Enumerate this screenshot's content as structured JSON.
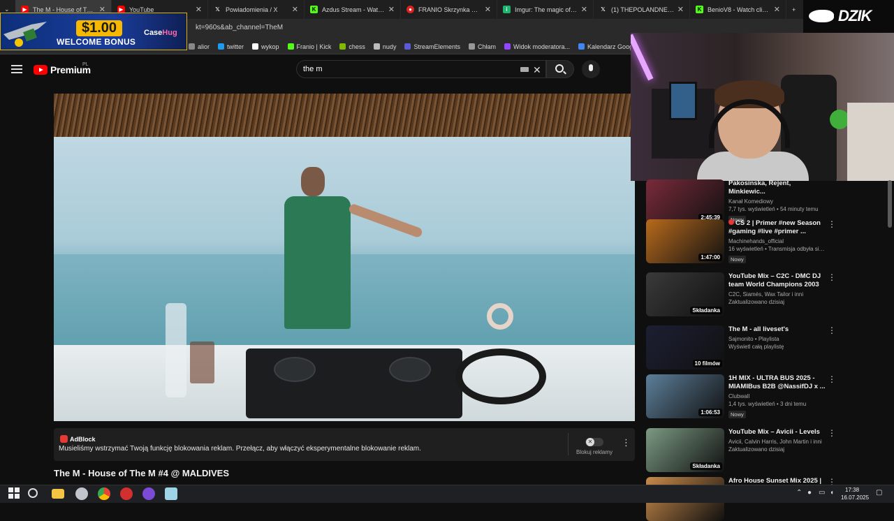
{
  "browser": {
    "tabs": [
      {
        "title": "The M - House of The M",
        "favicon": "youtube",
        "active": true
      },
      {
        "title": "YouTube",
        "favicon": "youtube",
        "active": false
      },
      {
        "title": "Powiadomienia / X",
        "favicon": "x",
        "active": false
      },
      {
        "title": "Azdus Stream - Watch Live",
        "favicon": "kick",
        "active": false
      },
      {
        "title": "FRANIO Skrzynka CS2 (CS)",
        "favicon": "csgo",
        "active": false
      },
      {
        "title": "Imgur: The magic of the",
        "favicon": "imgur",
        "active": false
      },
      {
        "title": "(1) THEPOLANDNEWS",
        "favicon": "x",
        "active": false
      },
      {
        "title": "BenioV8 - Watch clips on",
        "favicon": "kick",
        "active": false
      }
    ],
    "new_tab_label": "+",
    "url": "kt=960s&ab_channel=TheM",
    "bookmarks": [
      {
        "label": "alior"
      },
      {
        "label": "twitter"
      },
      {
        "label": "wykop"
      },
      {
        "label": "Franio | Kick"
      },
      {
        "label": "chess"
      },
      {
        "label": "nudy"
      },
      {
        "label": "StreamElements"
      },
      {
        "label": "Chłam"
      },
      {
        "label": "Widok moderatora..."
      },
      {
        "label": "Kalendarz Google -..."
      }
    ]
  },
  "overlay_ad": {
    "amount": "$1.00",
    "text": "WELCOME BONUS",
    "brand_a": "Case",
    "brand_b": "Hug"
  },
  "streamer_brand": "DZIK",
  "youtube": {
    "logo_text": "Premium",
    "region": "PL",
    "search_value": "the m",
    "adblock": {
      "brand": "AdBlock",
      "message": "Musieliśmy wstrzymać Twoją funkcję blokowania reklam. Przełącz, aby włączyć eksperymentalne blokowanie reklam.",
      "toggle_label": "Blokuj reklamy"
    },
    "video_title": "The M - House of The M #4 @ MALDIVES",
    "recommendations": [
      {
        "title": "Pakosinska, Rejent, Minkiewic...",
        "channel": "Kanał Komediowy",
        "views": "7,7 tys. wyświetleń • 54 minuty temu",
        "badge": "Nowy",
        "duration": "2:45:39",
        "thumb_color": "#7a2a3a",
        "live": false
      },
      {
        "title": "CS 2 | Primer #new Season #gaming #live #primer ...",
        "channel": "Machinehands_official",
        "views": "16 wyświetleń • Transmisja odbyła się 6 ...",
        "badge": "Nowy",
        "duration": "1:47:00",
        "thumb_color": "#b86a1c",
        "live": true
      },
      {
        "title": "YouTube Mix – C2C - DMC DJ team World Champions 2003 ...",
        "channel": "C2C, Siamés, Wax Tailor i inni",
        "views": "Zaktualizowano dzisiaj",
        "badge": "",
        "duration": "Składanka",
        "thumb_color": "#3a3a3a",
        "live": false
      },
      {
        "title": "The M - all liveset's",
        "channel": "Sajmonito • Playlista",
        "views": "Wyświetl całą playlistę",
        "badge": "",
        "duration": "10 filmów",
        "thumb_color": "#1c1f33",
        "live": false
      },
      {
        "title": "1H MIX - ULTRA BUS 2025 - MIAMIBus B2B @NassifDJ x ...",
        "channel": "Clubwall",
        "views": "1,4 tys. wyświetleń • 3 dni temu",
        "badge": "Nowy",
        "duration": "1:06:53",
        "thumb_color": "#5d7f9a",
        "live": false
      },
      {
        "title": "YouTube Mix – Avicii - Levels",
        "channel": "Avicii, Calvin Harris, John Martin i inni",
        "views": "Zaktualizowano dzisiaj",
        "badge": "",
        "duration": "Składanka",
        "thumb_color": "#7b9a83",
        "live": false
      },
      {
        "title": "Afro House Sunset Mix 2025 |",
        "channel": "",
        "views": "",
        "badge": "",
        "duration": "",
        "thumb_color": "#c98a4a",
        "live": false
      }
    ]
  },
  "taskbar": {
    "time": "17:38",
    "date": "16.07.2025"
  }
}
